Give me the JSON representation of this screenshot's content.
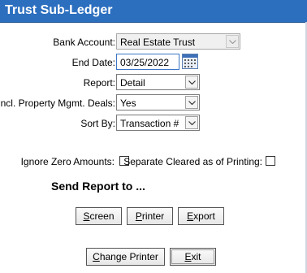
{
  "window": {
    "title": "Trust Sub-Ledger"
  },
  "form": {
    "bank_account": {
      "label": "Bank Account:",
      "value": "Real Estate Trust"
    },
    "end_date": {
      "label": "End Date:",
      "value": "03/25/2022"
    },
    "report": {
      "label": "Report:",
      "value": "Detail"
    },
    "incl_pm_deals": {
      "label": "Incl. Property Mgmt. Deals:",
      "value": "Yes"
    },
    "sort_by": {
      "label": "Sort By:",
      "value": "Transaction #"
    },
    "ignore_zero": {
      "label": "Ignore Zero Amounts:",
      "checked": false
    },
    "separate_cleared": {
      "label": "Separate Cleared as of Printing:",
      "checked": false
    }
  },
  "send_report": {
    "heading": "Send Report to ...",
    "screen_pre": "",
    "screen_key": "S",
    "screen_post": "creen",
    "printer_pre": "",
    "printer_key": "P",
    "printer_post": "rinter",
    "export_pre": "",
    "export_key": "E",
    "export_post": "xport"
  },
  "footer": {
    "change_printer_pre": "",
    "change_printer_key": "C",
    "change_printer_post": "hange Printer",
    "exit_pre": "",
    "exit_key": "E",
    "exit_post": "xit"
  },
  "icons": {
    "calendar": "calendar-icon",
    "dropdown": "chevron-down-icon"
  },
  "colors": {
    "titlebar": "#2c6fbf",
    "date_border": "#3b76c4"
  }
}
